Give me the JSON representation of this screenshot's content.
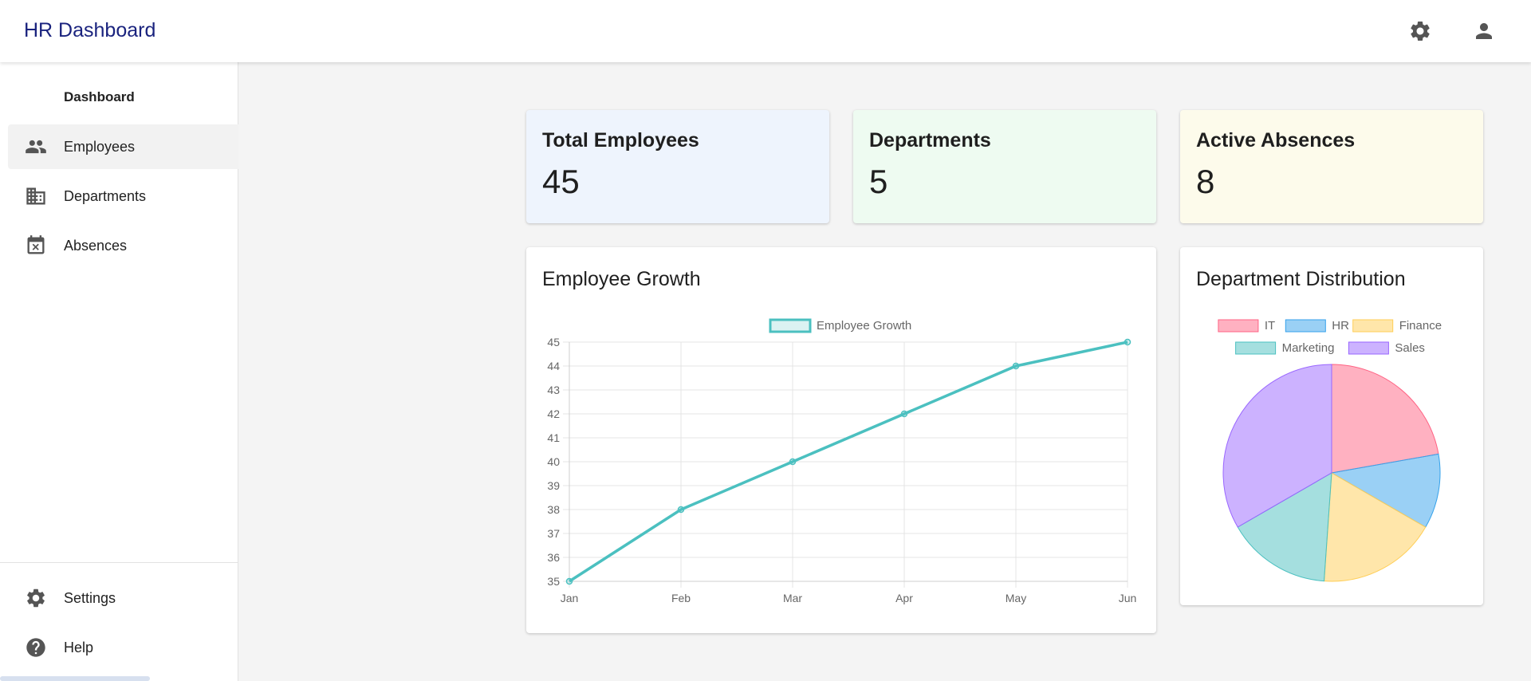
{
  "app": {
    "title": "HR Dashboard"
  },
  "header": {
    "settings_icon": "gear-icon",
    "account_icon": "person-icon"
  },
  "sidebar": {
    "items": [
      {
        "label": "Dashboard",
        "icon": ""
      },
      {
        "label": "Employees",
        "icon": "people-icon"
      },
      {
        "label": "Departments",
        "icon": "building-icon"
      },
      {
        "label": "Absences",
        "icon": "calendar-x-icon"
      }
    ],
    "bottom_items": [
      {
        "label": "Settings",
        "icon": "gear-icon"
      },
      {
        "label": "Help",
        "icon": "help-icon"
      }
    ]
  },
  "stats": [
    {
      "title": "Total Employees",
      "value": "45",
      "bg": "#eef4fd"
    },
    {
      "title": "Departments",
      "value": "5",
      "bg": "#eefbf1"
    },
    {
      "title": "Active Absences",
      "value": "8",
      "bg": "#fdfbeb"
    }
  ],
  "charts": {
    "growth_title": "Employee Growth",
    "distribution_title": "Department Distribution"
  },
  "chart_data": [
    {
      "type": "line",
      "categories": [
        "Jan",
        "Feb",
        "Mar",
        "Apr",
        "May",
        "Jun"
      ],
      "series": [
        {
          "name": "Employee Growth",
          "values": [
            35,
            38,
            40,
            42,
            44,
            45
          ],
          "color": "#4bc0c0"
        }
      ],
      "ylim": [
        35,
        45
      ],
      "yticks": [
        "35",
        "36",
        "37",
        "38",
        "39",
        "40",
        "41",
        "42",
        "43",
        "44",
        "45"
      ],
      "grid": true,
      "legend": "top-center"
    },
    {
      "type": "pie",
      "labels": [
        "IT",
        "HR",
        "Finance",
        "Marketing",
        "Sales"
      ],
      "values": [
        10,
        5,
        8,
        7,
        15
      ],
      "colors": [
        "#ff6384",
        "#36a2eb",
        "#ffce56",
        "#4bc0c0",
        "#9966ff"
      ],
      "legend": "top-center"
    }
  ]
}
